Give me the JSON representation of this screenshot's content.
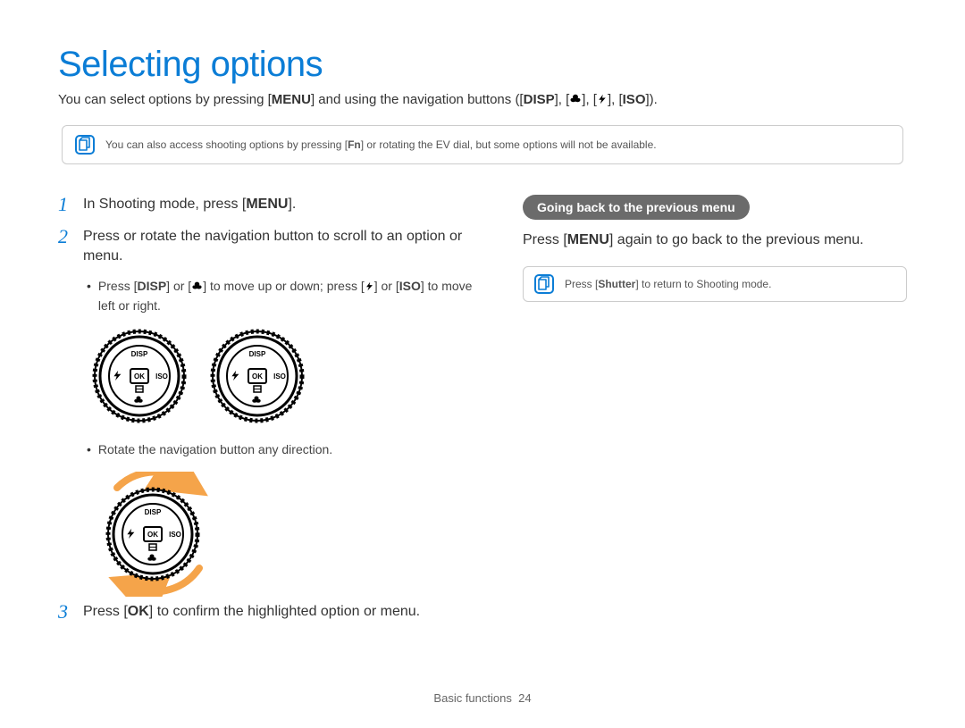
{
  "title": "Selecting options",
  "intro": {
    "pre": "You can select options by pressing [",
    "menu": "MENU",
    "mid1": "] and using the navigation buttons ([",
    "disp": "DISP",
    "mid2": "], [",
    "mid3": "], [",
    "mid4": "], [",
    "iso": "ISO",
    "post": "])."
  },
  "note1": {
    "pre": "You can also access shooting options by pressing [",
    "fn": "Fn",
    "post": "] or rotating the EV dial, but some options will not be available."
  },
  "steps": {
    "s1": {
      "num": "1",
      "pre": "In Shooting mode, press [",
      "menu": "MENU",
      "post": "]."
    },
    "s2": {
      "num": "2",
      "text": "Press or rotate the navigation button to scroll to an option or menu."
    },
    "s3": {
      "num": "3",
      "pre": "Press [",
      "ok": "OK",
      "post": "] to confirm the highlighted option or menu."
    }
  },
  "bullets": {
    "b1": {
      "pre": "Press [",
      "disp": "DISP",
      "m1": "] or [",
      "m2": "] to move up or down; press [",
      "m3": "] or [",
      "iso": "ISO",
      "post": "] to move left or right."
    },
    "b2": "Rotate the navigation button any direction."
  },
  "right": {
    "pill": "Going back to the previous menu",
    "line": {
      "pre": "Press [",
      "menu": "MENU",
      "post": "] again to go back to the previous menu."
    },
    "note": {
      "pre": "Press [",
      "shutter": "Shutter",
      "post": "] to return to Shooting mode."
    }
  },
  "dial": {
    "disp": "DISP",
    "ok": "OK",
    "iso": "ISO"
  },
  "footer": {
    "label": "Basic functions",
    "page": "24"
  }
}
